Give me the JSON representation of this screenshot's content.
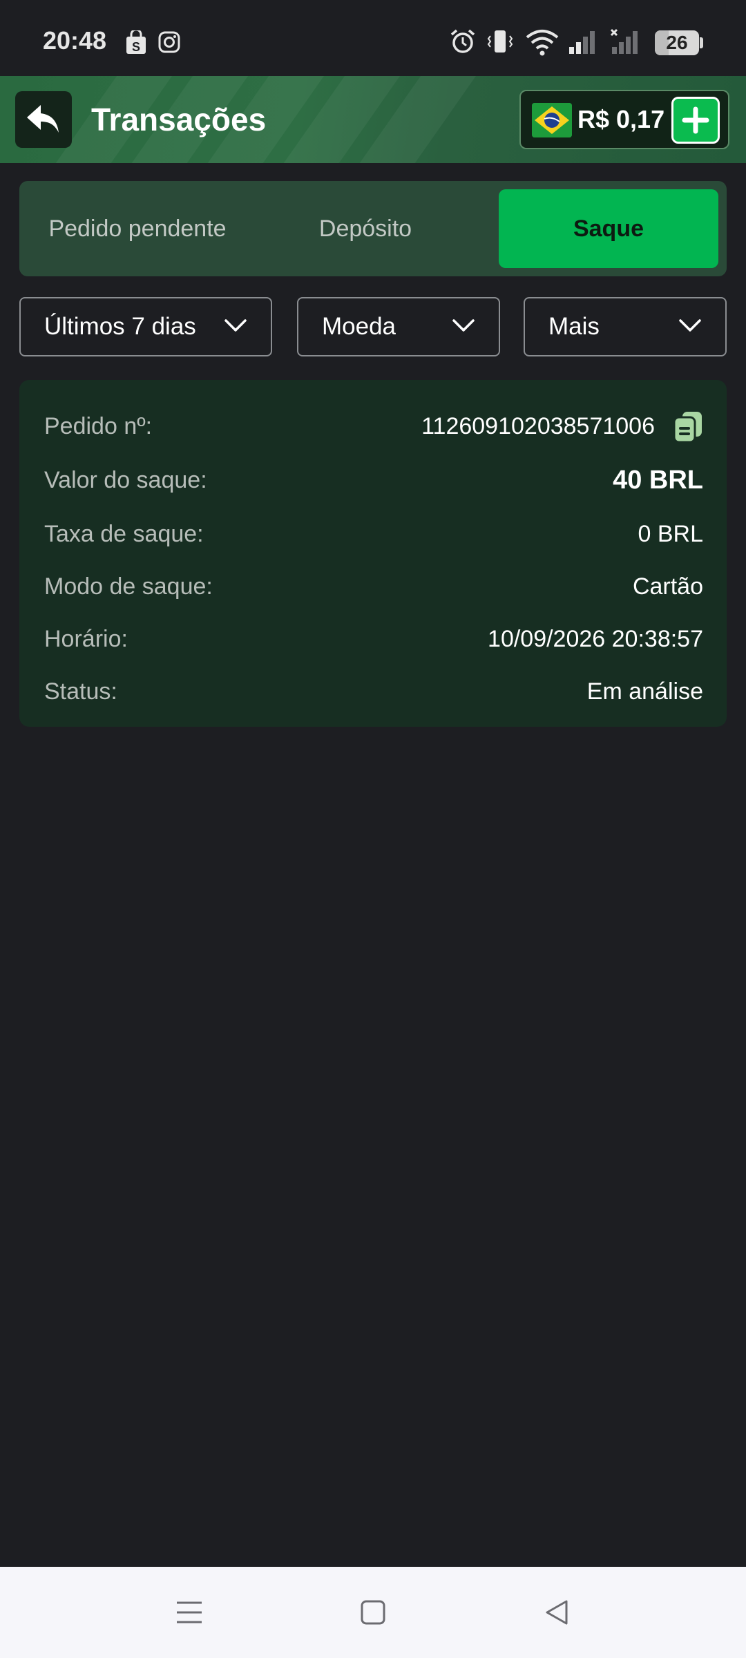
{
  "status_bar": {
    "time": "20:48",
    "battery": "26",
    "icons": [
      "shopping-bag-icon",
      "instagram-icon",
      "alarm-icon",
      "vibrate-icon",
      "wifi-icon",
      "signal-icon",
      "signal-no-service-icon",
      "battery-icon"
    ]
  },
  "header": {
    "title": "Transações",
    "balance": "R$ 0,17",
    "accent": "#0bbb4f"
  },
  "tabs": [
    {
      "label": "Pedido pendente",
      "active": false
    },
    {
      "label": "Depósito",
      "active": false
    },
    {
      "label": "Saque",
      "active": true
    }
  ],
  "filters": {
    "period": "Últimos 7 dias",
    "currency": "Moeda",
    "more": "Mais"
  },
  "transaction": {
    "order_label": "Pedido nº:",
    "order_value": "112609102038571006",
    "amount_label": "Valor do saque:",
    "amount_value": "40 BRL",
    "fee_label": "Taxa de saque:",
    "fee_value": "0 BRL",
    "mode_label": "Modo de saque:",
    "mode_value": "Cartão",
    "time_label": "Horário:",
    "time_value": "10/09/2026 20:38:57",
    "status_label": "Status:",
    "status_value": "Em análise"
  },
  "nav": [
    "menu-icon",
    "home-icon",
    "back-icon"
  ]
}
